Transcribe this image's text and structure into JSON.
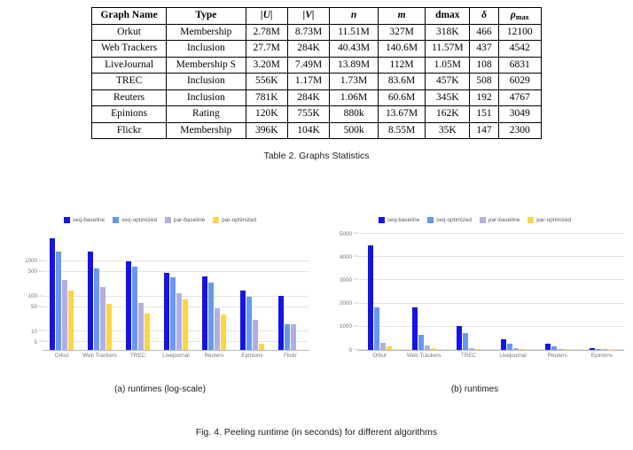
{
  "table": {
    "caption": "Table 2.  Graphs Statistics",
    "headers": [
      {
        "text": "Graph Name",
        "style": "plain"
      },
      {
        "text": "Type",
        "style": "plain"
      },
      {
        "text": "|U|",
        "style": "italic"
      },
      {
        "text": "|V|",
        "style": "italic"
      },
      {
        "text": "n",
        "style": "italic"
      },
      {
        "text": "m",
        "style": "italic"
      },
      {
        "text": "dmax",
        "style": "plain"
      },
      {
        "text": "δ",
        "style": "italic"
      },
      {
        "text": "ρmax",
        "style": "sub"
      }
    ],
    "rows": [
      {
        "name": "Orkut",
        "type": "Membership",
        "u": "2.78M",
        "v": "8.73M",
        "n": "11.51M",
        "m": "327M",
        "dmax": "318K",
        "delta": "466",
        "rho": "12100"
      },
      {
        "name": "Web Trackers",
        "type": "Inclusion",
        "u": "27.7M",
        "v": "284K",
        "n": "40.43M",
        "m": "140.6M",
        "dmax": "11.57M",
        "delta": "437",
        "rho": "4542"
      },
      {
        "name": "LiveJournal",
        "type": "Membership S",
        "u": "3.20M",
        "v": "7.49M",
        "n": "13.89M",
        "m": "112M",
        "dmax": "1.05M",
        "delta": "108",
        "rho": "6831"
      },
      {
        "name": "TREC",
        "type": "Inclusion",
        "u": "556K",
        "v": "1.17M",
        "n": "1.73M",
        "m": "83.6M",
        "dmax": "457K",
        "delta": "508",
        "rho": "6029"
      },
      {
        "name": "Reuters",
        "type": "Inclusion",
        "u": "781K",
        "v": "284K",
        "n": "1.06M",
        "m": "60.6M",
        "dmax": "345K",
        "delta": "192",
        "rho": "4767"
      },
      {
        "name": "Epinions",
        "type": "Rating",
        "u": "120K",
        "v": "755K",
        "n": "880k",
        "m": "13.67M",
        "dmax": "162K",
        "delta": "151",
        "rho": "3049"
      },
      {
        "name": "Flickr",
        "type": "Membership",
        "u": "396K",
        "v": "104K",
        "n": "500k",
        "m": "8.55M",
        "dmax": "35K",
        "delta": "147",
        "rho": "2300"
      }
    ]
  },
  "figure": {
    "caption": "Fig. 4.  Peeling runtime (in seconds) for different algorithms",
    "subcaption_a": "(a) runtimes (log-scale)",
    "subcaption_b": "(b) runtimes"
  },
  "colors": {
    "seq_baseline": "#1414e6",
    "seq_optimized": "#6699ee",
    "par_baseline": "#b3aee0",
    "par_optimized": "#fcd34d",
    "gridline": "#e3e3e3",
    "axis": "#b8b8b8",
    "tick_text": "#777777"
  },
  "chart_data": [
    {
      "id": "chart-a",
      "type": "bar",
      "title": "(a) runtimes (log-scale)",
      "xlabel": "",
      "ylabel": "",
      "yscale": "log",
      "ylim": [
        3,
        6000
      ],
      "yticks": [
        5,
        10,
        50,
        100,
        500,
        1000
      ],
      "ytick_labels": [
        "5",
        "10",
        "50",
        "100",
        "500",
        "1000"
      ],
      "grid": true,
      "legend_position": "top",
      "categories": [
        "Orkut",
        "Web Trackers",
        "TREC",
        "Livejournal",
        "Reuters",
        "Epinions",
        "Flickr"
      ],
      "series": [
        {
          "name": "seq-baseline",
          "color": "#1414e6",
          "values": [
            4500,
            1850,
            1020,
            460,
            372,
            150,
            105
          ]
        },
        {
          "name": "seq-optimized",
          "color": "#6699ee",
          "values": [
            1850,
            640,
            720,
            340,
            250,
            100,
            16
          ]
        },
        {
          "name": "par-baseline",
          "color": "#b3aee0",
          "values": [
            300,
            185,
            64,
            125,
            45,
            22,
            16
          ]
        },
        {
          "name": "par-optimized",
          "color": "#fcd34d",
          "values": [
            150,
            61,
            33,
            80,
            30,
            4.5,
            0
          ]
        }
      ]
    },
    {
      "id": "chart-b",
      "type": "bar",
      "title": "(b) runtimes",
      "xlabel": "",
      "ylabel": "",
      "yscale": "linear",
      "ylim": [
        0,
        5000
      ],
      "yticks": [
        0,
        1000,
        2000,
        3000,
        4000,
        5000
      ],
      "ytick_labels": [
        "0",
        "1000",
        "2000",
        "3000",
        "4000",
        "5000"
      ],
      "grid": true,
      "legend_position": "top",
      "categories": [
        "Orkut",
        "Web Trackers",
        "TREC",
        "Livejournal",
        "Reuters",
        "Epinions"
      ],
      "series": [
        {
          "name": "seq-baseline",
          "color": "#1414e6",
          "values": [
            4500,
            1850,
            1020,
            460,
            250,
            75
          ]
        },
        {
          "name": "seq-optimized",
          "color": "#6699ee",
          "values": [
            1850,
            640,
            720,
            250,
            150,
            40
          ]
        },
        {
          "name": "par-baseline",
          "color": "#b3aee0",
          "values": [
            300,
            185,
            64,
            64,
            45,
            22
          ]
        },
        {
          "name": "par-optimized",
          "color": "#fcd34d",
          "values": [
            150,
            61,
            33,
            45,
            30,
            5
          ]
        }
      ]
    }
  ],
  "legend": {
    "entries": [
      {
        "label": "seq-baseline",
        "color": "#1414e6"
      },
      {
        "label": "seq-optimized",
        "color": "#6699ee"
      },
      {
        "label": "par-baseline",
        "color": "#b3aee0"
      },
      {
        "label": "par-optimized",
        "color": "#fcd34d"
      }
    ]
  }
}
